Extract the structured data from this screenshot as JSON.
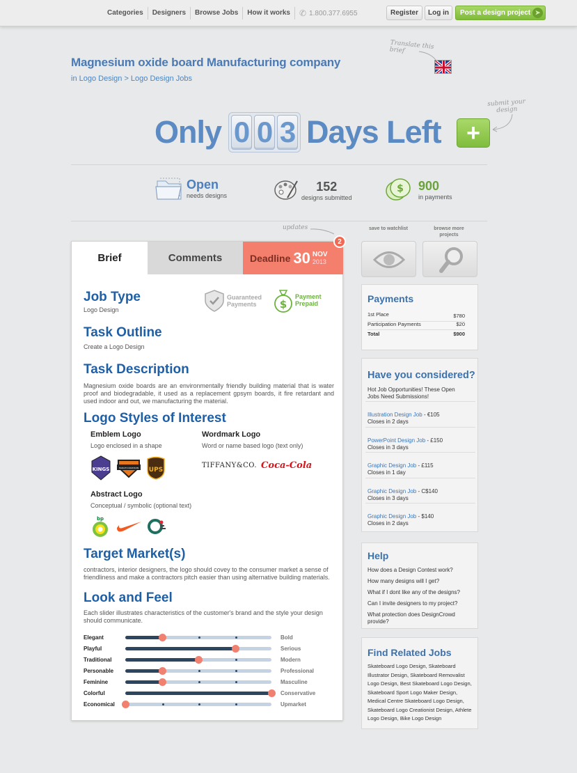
{
  "nav": {
    "items": [
      "Categories",
      "Designers",
      "Browse Jobs",
      "How it works"
    ],
    "phone": "1.800.377.6955",
    "register": "Register",
    "login": "Log in",
    "post": "Post a design project"
  },
  "header": {
    "title": "Magnesium oxide board Manufacturing company",
    "breadcrumb": "in Logo Design > Logo Design Jobs",
    "translate_note": "Translate this brief",
    "days_prefix": "Only",
    "days_digits": [
      "0",
      "0",
      "3"
    ],
    "days_suffix": "Days Left",
    "submit_note": "submit your design"
  },
  "stats": {
    "status": "Open",
    "status_sub": "needs designs",
    "designs": "152",
    "designs_sub": "designs submitted",
    "payments": "900",
    "payments_sub": "in payments"
  },
  "tabs": {
    "brief": "Brief",
    "comments": "Comments",
    "deadline": "Deadline",
    "deadline_day": "30",
    "deadline_month": "NOV",
    "deadline_year": "2013",
    "updates_note": "updates",
    "badge": "2"
  },
  "brief": {
    "job_type_h": "Job Type",
    "job_type": "Logo Design",
    "guaranteed": "Guaranteed Payments",
    "prepaid": "Payment Prepaid",
    "task_outline_h": "Task Outline",
    "task_outline": "Create a Logo Design",
    "task_desc_h": "Task Description",
    "task_desc": "Magnesium oxide boards are an environmentally friendly building material that is water proof and biodegradable, it used as a replacement gpsym boards, it fire retardant and used indoor and out, we manufacturing the material.",
    "styles_h": "Logo Styles of Interest",
    "emblem_h": "Emblem Logo",
    "emblem_t": "Logo enclosed in a shape",
    "wordmark_h": "Wordmark Logo",
    "wordmark_t": "Word or name based logo (text only)",
    "abstract_h": "Abstract Logo",
    "abstract_t": "Conceptual / symbolic (optional text)",
    "logo_kings": "KINGS",
    "logo_hd": "HARLEY-DAVIDSON",
    "logo_ups": "UPS",
    "logo_tiffany": "TIFFANY&CO.",
    "logo_coke": "Coca-Cola",
    "logo_bp": "bp",
    "target_h": "Target Market(s)",
    "target_t": "contractors, interior designers, the logo should covey to the consumer market a sense of friendliness and make a contractors pitch easier than using alternative building materials.",
    "look_h": "Look and Feel",
    "look_t": "Each slider illustrates characteristics of the customer's brand and the style your design should communicate."
  },
  "sliders": [
    {
      "left": "Elegant",
      "right": "Bold",
      "level": 0.25
    },
    {
      "left": "Playful",
      "right": "Serious",
      "level": 0.75
    },
    {
      "left": "Traditional",
      "right": "Modern",
      "level": 0.5
    },
    {
      "left": "Personable",
      "right": "Professional",
      "level": 0.25
    },
    {
      "left": "Feminine",
      "right": "Masculine",
      "level": 0.25
    },
    {
      "left": "Colorful",
      "right": "Conservative",
      "level": 1.0
    },
    {
      "left": "Economical",
      "right": "Upmarket",
      "level": 0.0
    }
  ],
  "sidebar": {
    "watch_label": "save to watchlist",
    "browse_label": "browse more projects",
    "payments_h": "Payments",
    "payments": [
      {
        "label": "1st Place",
        "value": "$780"
      },
      {
        "label": "Participation Payments",
        "value": "$20"
      },
      {
        "label": "Total",
        "value": "$900"
      }
    ],
    "considered_h": "Have you considered?",
    "considered_intro": "Hot Job Opportunities! These Open Jobs Need Submissions!",
    "jobs": [
      {
        "link": "Illustration Design Job",
        "price": " - €105",
        "closes": "Closes in 2 days"
      },
      {
        "link": "PowerPoint Design Job",
        "price": " - £150",
        "closes": "Closes in 3 days"
      },
      {
        "link": "Graphic Design Job",
        "price": " - £115",
        "closes": "Closes in 1 day"
      },
      {
        "link": "Graphic Design Job",
        "price": " - C$140",
        "closes": "Closes in 3 days"
      },
      {
        "link": "Graphic Design Job",
        "price": " - $140",
        "closes": "Closes in 2 days"
      }
    ],
    "help_h": "Help",
    "help": [
      "How does a Design Contest work?",
      "How many designs will I get?",
      "What if I dont like any of the designs?",
      "Can I invite designers to my project?",
      "What protection does DesignCrowd provide?"
    ],
    "related_h": "Find Related Jobs",
    "related": "Skateboard Logo Design, Skateboard Illustrator Design, Skateboard Removalist Logo Design, Best Skateboard Logo Design, Skateboard Sport Logo Maker Design, Medical Centre Skateboard Logo Design, Skateboard Logo Creationist Design, Athlete Logo Design, Bike Logo Design"
  }
}
